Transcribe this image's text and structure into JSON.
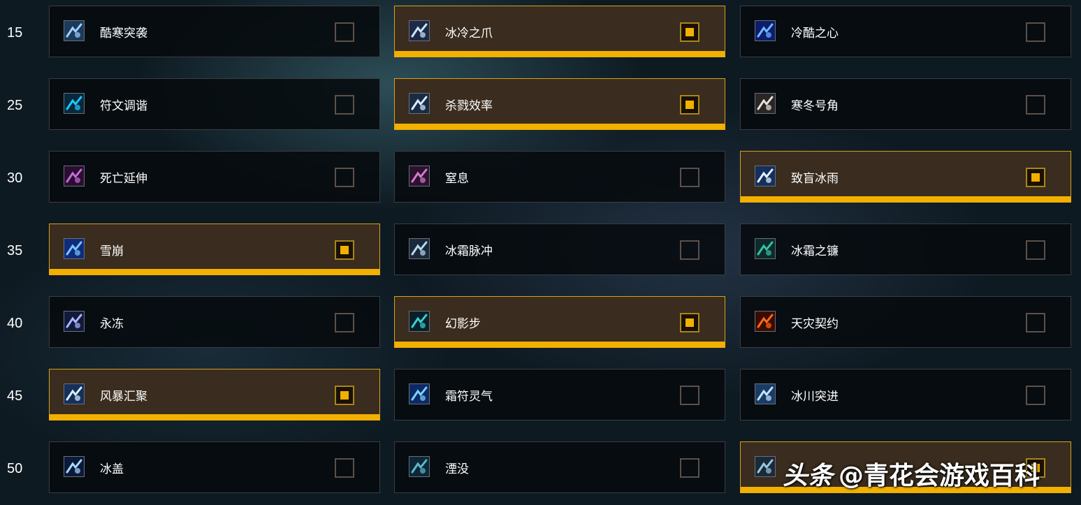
{
  "colors": {
    "accent": "#f2b000",
    "selected_bg": "#3a2c1e",
    "card_bg": "#06090e"
  },
  "rows": [
    {
      "level": "15",
      "talents": [
        {
          "name": "酷寒突袭",
          "icon": "frost-strike-icon",
          "selected": false
        },
        {
          "name": "冰冷之爪",
          "icon": "frost-claw-icon",
          "selected": true
        },
        {
          "name": "冷酷之心",
          "icon": "frost-orb-icon",
          "selected": false
        }
      ]
    },
    {
      "level": "25",
      "talents": [
        {
          "name": "符文调谐",
          "icon": "rune-icon",
          "selected": false
        },
        {
          "name": "杀戮效率",
          "icon": "frost-skull-icon",
          "selected": true
        },
        {
          "name": "寒冬号角",
          "icon": "horn-icon",
          "selected": false
        }
      ]
    },
    {
      "level": "30",
      "talents": [
        {
          "name": "死亡延伸",
          "icon": "shadow-tendril-icon",
          "selected": false
        },
        {
          "name": "窒息",
          "icon": "shadow-hand-icon",
          "selected": false
        },
        {
          "name": "致盲冰雨",
          "icon": "ice-shards-icon",
          "selected": true
        }
      ]
    },
    {
      "level": "35",
      "talents": [
        {
          "name": "雪崩",
          "icon": "avalanche-icon",
          "selected": true
        },
        {
          "name": "冰霜脉冲",
          "icon": "frost-pulse-icon",
          "selected": false
        },
        {
          "name": "冰霜之镰",
          "icon": "frost-scythe-icon",
          "selected": false
        }
      ]
    },
    {
      "level": "40",
      "talents": [
        {
          "name": "永冻",
          "icon": "permafrost-icon",
          "selected": false
        },
        {
          "name": "幻影步",
          "icon": "wraith-walk-icon",
          "selected": true
        },
        {
          "name": "天灾契约",
          "icon": "flame-fist-icon",
          "selected": false
        }
      ]
    },
    {
      "level": "45",
      "talents": [
        {
          "name": "风暴汇聚",
          "icon": "gathering-storm-icon",
          "selected": true
        },
        {
          "name": "霜符灵气",
          "icon": "frost-rune-icon",
          "selected": false
        },
        {
          "name": "冰川突进",
          "icon": "glacial-advance-icon",
          "selected": false
        }
      ]
    },
    {
      "level": "50",
      "talents": [
        {
          "name": "冰盖",
          "icon": "icecap-icon",
          "selected": false
        },
        {
          "name": "湮没",
          "icon": "obliteration-icon",
          "selected": false
        },
        {
          "name": "",
          "icon": "frostwyrm-icon",
          "selected": true
        }
      ]
    }
  ],
  "watermark": {
    "brand": "头条",
    "text": "@青花会游戏百科"
  }
}
